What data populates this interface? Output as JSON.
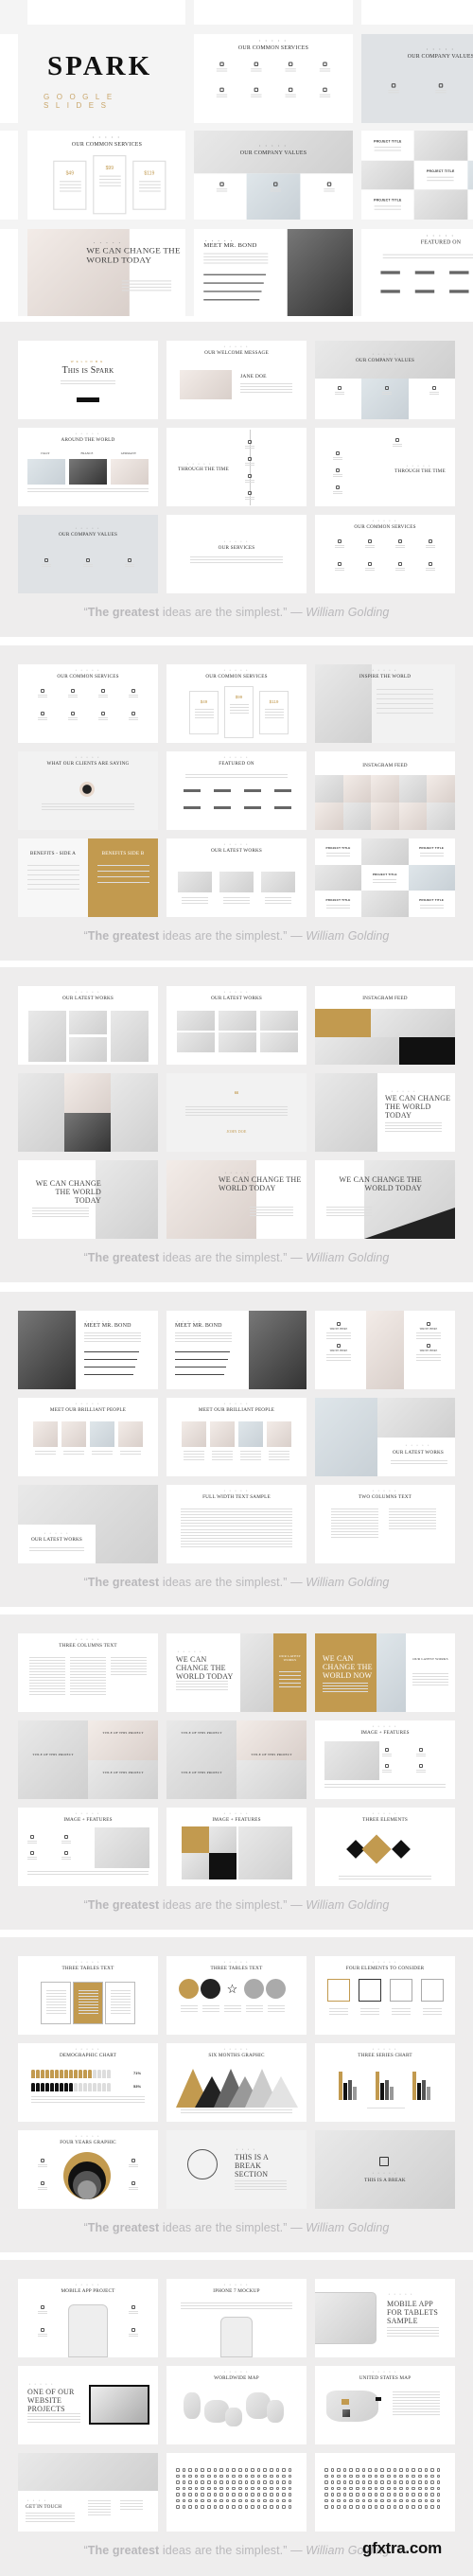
{
  "hero": {
    "brand_title": "SPARK",
    "brand_subtitle": "GOOGLE SLIDES",
    "slides": [
      {
        "title": "Our Common Services",
        "kind": "icons"
      },
      {
        "title": "Our Company Values",
        "kind": "values-gray"
      },
      {
        "title": "Our Common Services",
        "kind": "pricing",
        "prices": [
          "$49",
          "$99",
          "$119"
        ]
      },
      {
        "title": "Our Company Values",
        "kind": "values"
      },
      {
        "title": "Project Title",
        "kind": "projects"
      },
      {
        "title": "We can Change The World Today",
        "kind": "face"
      },
      {
        "title": "Meet Mr. Bond",
        "kind": "bond-right"
      },
      {
        "title": "Featured On",
        "kind": "logos"
      }
    ]
  },
  "quote": {
    "open": "“",
    "bold": "The greatest",
    "rest": " ideas are the simplest.” — ",
    "author": "William Golding"
  },
  "colors": {
    "accent_gold": "#c29a4f",
    "panel_bg": "#eeeded",
    "quote_text": "#b9b8bb"
  },
  "panels": [
    {
      "slides": [
        {
          "title": "This is Spark",
          "kind": "welcome",
          "kicker": "WELCOME"
        },
        {
          "title": "Our Welcome Message",
          "kind": "welcome-msg",
          "name": "Jane Doe"
        },
        {
          "title": "Our Company Values",
          "kind": "values"
        },
        {
          "title": "Around the World",
          "kind": "world",
          "labels": [
            "Italy",
            "France",
            "Germany"
          ]
        },
        {
          "title": "Through the Time",
          "kind": "timeline-right"
        },
        {
          "title": "Through the Time",
          "kind": "timeline-left"
        },
        {
          "title": "Our Company Values",
          "kind": "values-gray"
        },
        {
          "title": "Our Services",
          "kind": "text-center"
        },
        {
          "title": "Our Common Services",
          "kind": "icons"
        }
      ]
    },
    {
      "slides": [
        {
          "title": "Our Common Services",
          "kind": "icons"
        },
        {
          "title": "Our Common Services",
          "kind": "pricing",
          "prices": [
            "$49",
            "$99",
            "$119"
          ]
        },
        {
          "title": "Inspire the World",
          "kind": "inspire"
        },
        {
          "title": "What our Clients are Saying",
          "kind": "clients"
        },
        {
          "title": "Featured On",
          "kind": "logos"
        },
        {
          "title": "Instagram Feed",
          "kind": "insta"
        },
        {
          "title": "Benefits - Side A",
          "kind": "benefits",
          "title_b": "Benefits Side B"
        },
        {
          "title": "Our Latest Works",
          "kind": "works3"
        },
        {
          "title": "Project Title",
          "kind": "projects"
        }
      ]
    },
    {
      "slides": [
        {
          "title": "Our Latest Works",
          "kind": "works-collage"
        },
        {
          "title": "Our Latest Works",
          "kind": "works-grid"
        },
        {
          "title": "Instagram Feed",
          "kind": "insta-gold"
        },
        {
          "title": "",
          "kind": "collage"
        },
        {
          "title": "John Doe",
          "kind": "quote-slide"
        },
        {
          "title": "We can Change The World Today",
          "kind": "photo-left"
        },
        {
          "title": "We can Change The World Today",
          "kind": "photo-right"
        },
        {
          "title": "We can Change The World Today",
          "kind": "face"
        },
        {
          "title": "We can Change The World Today",
          "kind": "road"
        }
      ]
    },
    {
      "slides": [
        {
          "title": "Meet Mr. Bond",
          "kind": "bond-left"
        },
        {
          "title": "Meet Mr. Bond",
          "kind": "bond-right"
        },
        {
          "title": "Write Here",
          "kind": "woman"
        },
        {
          "title": "Meet our Brilliant People",
          "kind": "people"
        },
        {
          "title": "Meet our Brilliant People",
          "kind": "people-bars"
        },
        {
          "title": "Our Latest Works",
          "kind": "walker"
        },
        {
          "title": "Our Latest Works",
          "kind": "cat"
        },
        {
          "title": "Full Width Text Sample",
          "kind": "fulltext"
        },
        {
          "title": "Two Columns Text",
          "kind": "twocol"
        }
      ]
    },
    {
      "slides": [
        {
          "title": "Three Columns Text",
          "kind": "threecol"
        },
        {
          "title": "We can Change The World Today",
          "kind": "stairs-gold",
          "title_b": "Our Latest Works"
        },
        {
          "title": "We can Change The World Now",
          "kind": "gold-left",
          "title_b": "Our Latest Works"
        },
        {
          "title": "Title of this Project",
          "kind": "project-tiles"
        },
        {
          "title": "Title of this Project",
          "kind": "project-tiles2"
        },
        {
          "title": "Image + Features",
          "kind": "img-features"
        },
        {
          "title": "Image + Features",
          "kind": "img-features2"
        },
        {
          "title": "Image + Features",
          "kind": "img-features3"
        },
        {
          "title": "Three Elements",
          "kind": "diamonds"
        }
      ]
    },
    {
      "slides": [
        {
          "title": "Three Tables Text",
          "kind": "tables"
        },
        {
          "title": "Three Tables Text",
          "kind": "circles"
        },
        {
          "title": "Four Elements to Consider",
          "kind": "squares"
        },
        {
          "title": "Demographic Chart",
          "kind": "demo",
          "values": [
            "71%",
            "53%"
          ]
        },
        {
          "title": "Six Months Graphic",
          "kind": "mountains"
        },
        {
          "title": "Three Series Chart",
          "kind": "bars"
        },
        {
          "title": "Four Years Graphic",
          "kind": "years"
        },
        {
          "title": "This is a Break Section",
          "kind": "watch"
        },
        {
          "title": "This is a Break",
          "kind": "break"
        }
      ]
    },
    {
      "slides": [
        {
          "title": "Mobile App Project",
          "kind": "phone"
        },
        {
          "title": "iPhone 7 Mockup",
          "kind": "phone2"
        },
        {
          "title": "Mobile App for Tablets Sample",
          "kind": "tablet"
        },
        {
          "title": "One of our Website Projects",
          "kind": "monitor"
        },
        {
          "title": "Worldwide Map",
          "kind": "map"
        },
        {
          "title": "United States Map",
          "kind": "usmap"
        },
        {
          "title": "Get in Touch",
          "kind": "contact"
        },
        {
          "title": "",
          "kind": "iconsheet"
        },
        {
          "title": "",
          "kind": "iconsheet"
        }
      ]
    }
  ],
  "watermark": "gfxtra.com"
}
